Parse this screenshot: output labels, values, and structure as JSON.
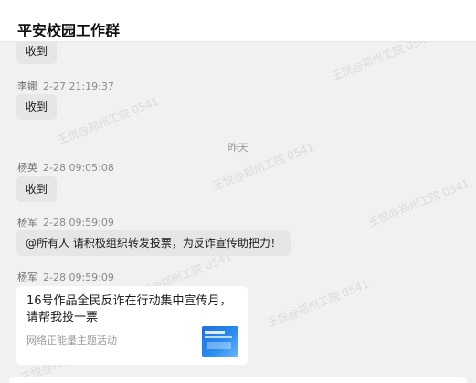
{
  "header": {
    "title": "平安校园工作群"
  },
  "watermark": {
    "text": "王悦@郑州工院 0541"
  },
  "messages": [
    {
      "sender": "",
      "time": "",
      "text": "收到"
    },
    {
      "sender": "李娜",
      "time": "2-27 21:19:37",
      "text": "收到"
    },
    {
      "sender": "杨英",
      "time": "2-28 09:05:08",
      "text": "收到"
    },
    {
      "sender": "杨军",
      "time": "2-28 09:59:09",
      "text": "@所有人 请积极组织转发投票，为反诈宣传助把力！"
    },
    {
      "sender": "杨军",
      "time": "2-28 09:59:09",
      "text": ""
    }
  ],
  "separator": {
    "label": "昨天"
  },
  "card": {
    "title": "16号作品全民反诈在行动集中宣传月，请帮我投一票",
    "source": "网络正能量主题活动",
    "thumb_color": "#2a8cf0"
  }
}
